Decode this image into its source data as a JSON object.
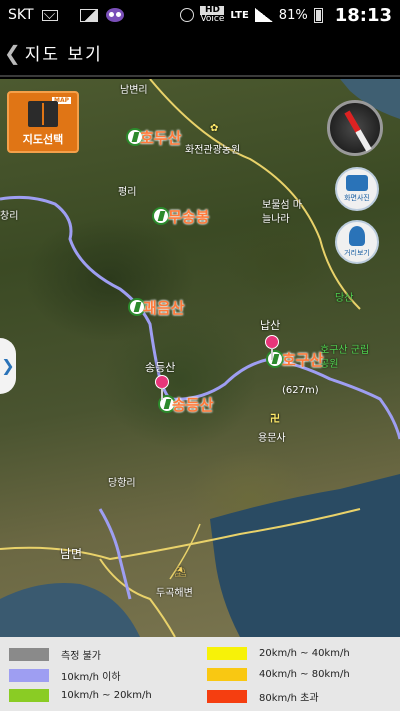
{
  "status_bar": {
    "carrier": "SKT",
    "hd_label": "HD",
    "voice_label": "Voice",
    "network": "LTE",
    "battery": "81%",
    "time": "18:13"
  },
  "header": {
    "back_icon": "chevron-left-icon",
    "title": "지도 보기"
  },
  "map": {
    "map_select_button": {
      "label": "지도선택",
      "tag": "MAP",
      "icon": "map-book-icon"
    },
    "compass_icon": "compass-icon",
    "camera_button": {
      "label": "화면사진",
      "icon": "camera-icon"
    },
    "street_view_button": {
      "label": "거리보기",
      "icon": "street-view-icon"
    },
    "side_handle": "❯",
    "mountains": [
      {
        "name": "호두산"
      },
      {
        "name": "무송봉"
      },
      {
        "name": "괘음산"
      },
      {
        "name": "호구산"
      },
      {
        "name": "송등산"
      }
    ],
    "pins": [
      {
        "name": "납산"
      },
      {
        "name": "송등산"
      }
    ],
    "places": [
      "남변리",
      "화전관광농원",
      "평리",
      "보물섬 마늘나라",
      "당산",
      "용문사",
      "당항리",
      "남면",
      "두곡해변",
      "호구산 군립공원",
      "(627m)",
      "창리"
    ]
  },
  "legend": {
    "items": [
      {
        "label": "측정 불가",
        "color": "#8a8a8a"
      },
      {
        "label": "10km/h 이하",
        "color": "#9e9ef2"
      },
      {
        "label": "10km/h ~ 20km/h",
        "color": "#8acc24"
      },
      {
        "label": "20km/h ~ 40km/h",
        "color": "#f7f208"
      },
      {
        "label": "40km/h ~ 80km/h",
        "color": "#f9c812"
      },
      {
        "label": "80km/h 초과",
        "color": "#f53e10"
      }
    ]
  }
}
